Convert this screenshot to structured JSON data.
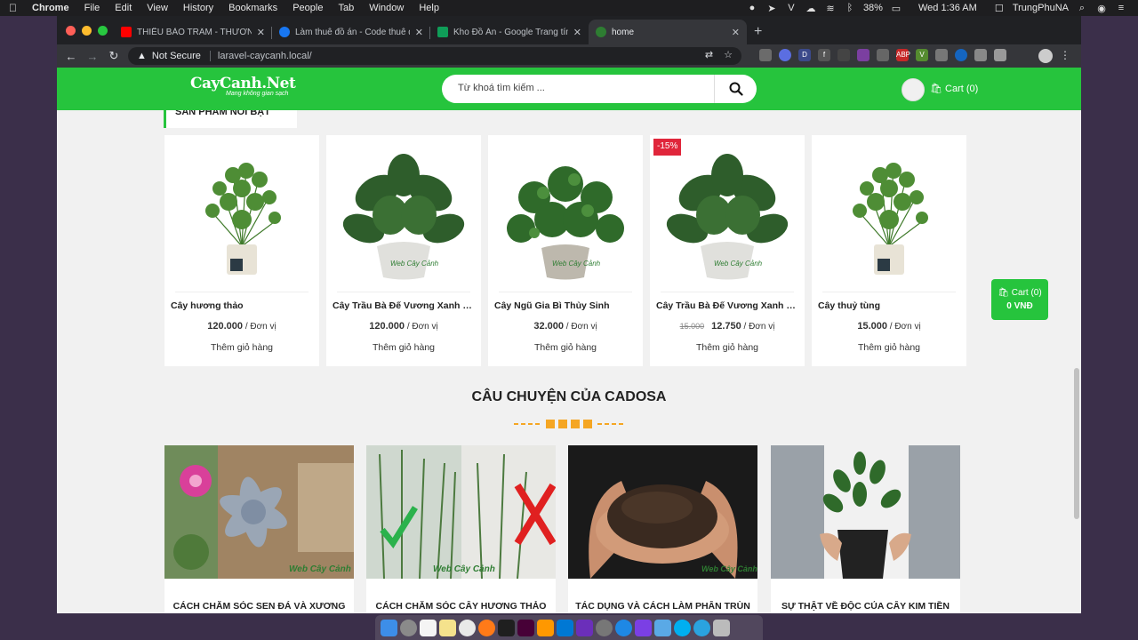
{
  "menubar": {
    "app": "Chrome",
    "items": [
      "File",
      "Edit",
      "View",
      "History",
      "Bookmarks",
      "People",
      "Tab",
      "Window",
      "Help"
    ],
    "battery": "38%",
    "clock": "Wed 1:36 AM",
    "user": "TrungPhuNA"
  },
  "browser": {
    "tabs": [
      {
        "title": "THIẾU BẢO TRÂM - THƯƠNG",
        "color": "#ff0000"
      },
      {
        "title": "Làm thuê đồ án - Code thuê đồ",
        "color": "#1877f2"
      },
      {
        "title": "Kho Đồ Án - Google Trang tính",
        "color": "#0f9d58"
      },
      {
        "title": "home",
        "color": "#2e7d32"
      }
    ],
    "security": "Not Secure",
    "url": "laravel-caycanh.local/"
  },
  "site": {
    "logo": "CayCanh.Net",
    "tagline": "Mang không gian sạch",
    "search_placeholder": "Từ khoá tìm kiếm ...",
    "cart_label": "Cart (0)",
    "section_label": "SẢN PHẨM NỔI BẬT",
    "products": [
      {
        "name": "Cây hương thảo",
        "price": "120.000",
        "old_price": "",
        "badge": "",
        "unit": "/ Đơn vị",
        "add": "Thêm giỏ hàng"
      },
      {
        "name": "Cây Trầu Bà Đế Vương Xanh thủ...",
        "price": "120.000",
        "old_price": "",
        "badge": "",
        "unit": "/ Đơn vị",
        "add": "Thêm giỏ hàng"
      },
      {
        "name": "Cây Ngũ Gia Bì Thủy Sinh",
        "price": "32.000",
        "old_price": "",
        "badge": "",
        "unit": "/ Đơn vị",
        "add": "Thêm giỏ hàng"
      },
      {
        "name": "Cây Trầu Bà Đế Vương Xanh thủ...",
        "price": "12.750",
        "old_price": "15.000",
        "badge": "-15%",
        "unit": "/ Đơn vị",
        "add": "Thêm giỏ hàng"
      },
      {
        "name": "Cây thuỷ tùng",
        "price": "15.000",
        "old_price": "",
        "badge": "",
        "unit": "/ Đơn vị",
        "add": "Thêm giỏ hàng"
      }
    ],
    "float_cart": {
      "label": "Cart (0)",
      "total": "0 VNĐ"
    },
    "story_title": "CÂU CHUYỆN CỦA CADOSA",
    "stories": [
      {
        "caption": "CÁCH CHĂM SÓC SEN ĐÁ VÀ XƯƠNG"
      },
      {
        "caption": "CÁCH CHĂM SÓC CÂY HƯƠNG THẢO"
      },
      {
        "caption": "TÁC DỤNG VÀ CÁCH LÀM PHÂN TRÙN"
      },
      {
        "caption": "SỰ THẬT VỀ ĐỘC CỦA CÂY KIM TIỀN"
      }
    ],
    "watermark": "Web Cây Cảnh",
    "colors": {
      "brand_green": "#26c43d",
      "sale_red": "#e0263b",
      "deco_orange": "#f5a623"
    }
  }
}
